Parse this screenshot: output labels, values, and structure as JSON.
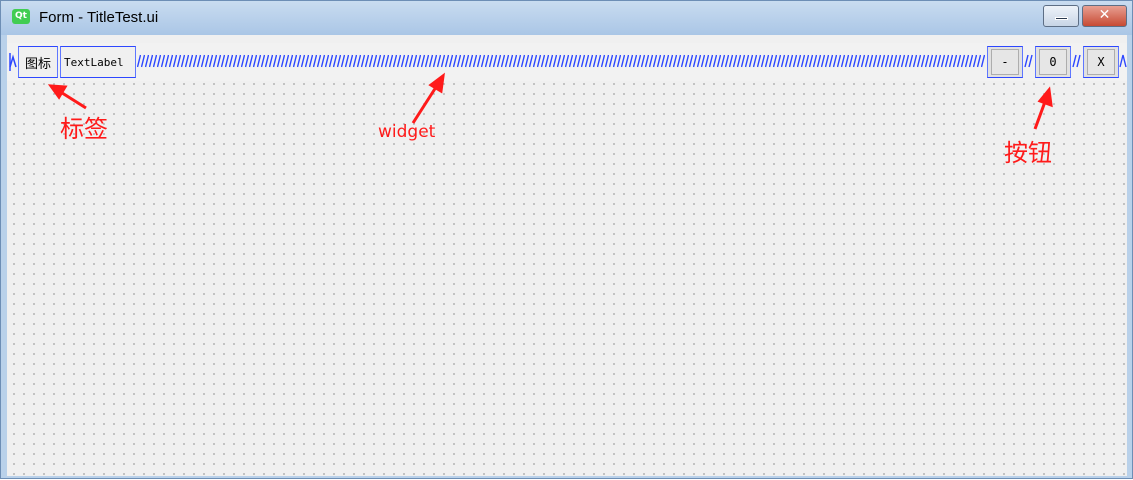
{
  "window": {
    "app_icon_text": "Qt",
    "title": "Form - TitleTest.ui",
    "close_glyph": "✕"
  },
  "form": {
    "icon_label": "图标",
    "text_label": "TextLabel",
    "buttons": {
      "minimize": "-",
      "maximize": "0",
      "close": "X"
    }
  },
  "annotations": {
    "label": "标签",
    "widget": "widget",
    "button": "按钮",
    "color": "#ff1a1a"
  },
  "colors": {
    "spacer_blue": "#2d47ff",
    "qt_green": "#41cd52",
    "canvas": "#f0f0f0"
  }
}
